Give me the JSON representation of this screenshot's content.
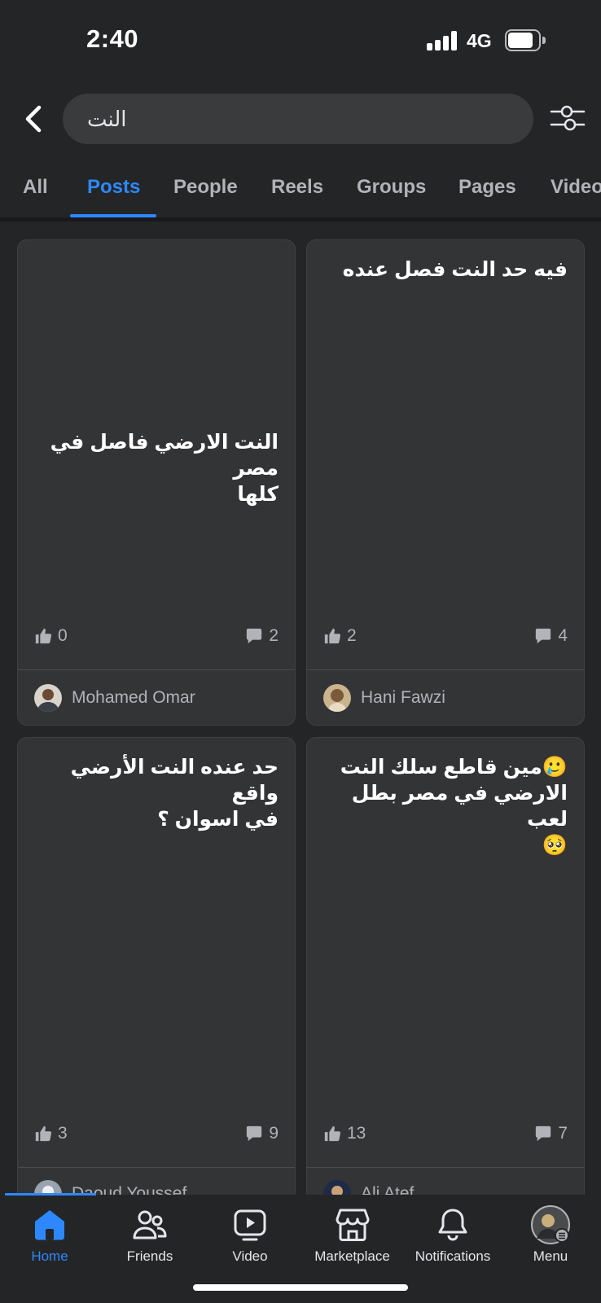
{
  "status_bar": {
    "time": "2:40",
    "network": "4G"
  },
  "search": {
    "query": "النت"
  },
  "tabs": [
    {
      "label": "All"
    },
    {
      "label": "Posts"
    },
    {
      "label": "People"
    },
    {
      "label": "Reels"
    },
    {
      "label": "Groups"
    },
    {
      "label": "Pages"
    },
    {
      "label": "Video"
    }
  ],
  "active_tab": "Posts",
  "posts": [
    {
      "text": "النت الارضي فاصل في مصر\nكلها",
      "likes": "0",
      "comments": "2",
      "author": "Mohamed Omar"
    },
    {
      "text": "فيه حد النت فصل عنده",
      "likes": "2",
      "comments": "4",
      "author": "Hani Fawzi"
    },
    {
      "text": "حد عنده النت الأرضي واقع\nفي اسوان ؟",
      "likes": "3",
      "comments": "9",
      "author": "Daoud Youssef"
    },
    {
      "text": "🥲مين قاطع سلك النت\nالارضي في مصر بطل لعب\n🥺",
      "likes": "13",
      "comments": "7",
      "author": "Ali Atef"
    }
  ],
  "bottom_nav": [
    {
      "label": "Home",
      "icon": "home-icon"
    },
    {
      "label": "Friends",
      "icon": "friends-icon"
    },
    {
      "label": "Video",
      "icon": "video-icon"
    },
    {
      "label": "Marketplace",
      "icon": "marketplace-icon"
    },
    {
      "label": "Notifications",
      "icon": "bell-icon"
    },
    {
      "label": "Menu",
      "icon": "avatar-menu-icon"
    }
  ],
  "colors": {
    "accent": "#2d88ff",
    "background": "#242526",
    "card": "#333436"
  }
}
